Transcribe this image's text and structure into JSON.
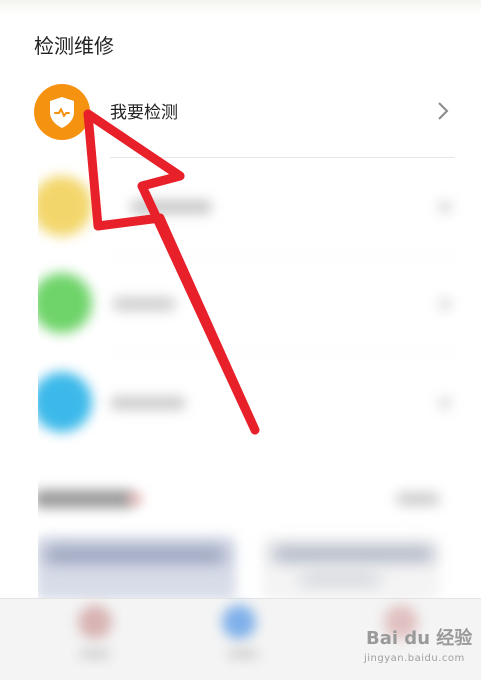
{
  "section": {
    "title": "检测维修"
  },
  "primary_item": {
    "label": "我要检测",
    "icon": "shield-pulse-icon",
    "icon_color": "#f5920f"
  },
  "blurred_items": [
    {
      "icon_color": "#f3d66b"
    },
    {
      "icon_color": "#6fd46a"
    },
    {
      "icon_color": "#3cb9ea"
    }
  ],
  "watermark": {
    "text": "Bai du 经验",
    "sub": "jingyan.baidu.com"
  },
  "colors": {
    "arrow": "#e8202a",
    "divider": "#e6e6e6"
  }
}
